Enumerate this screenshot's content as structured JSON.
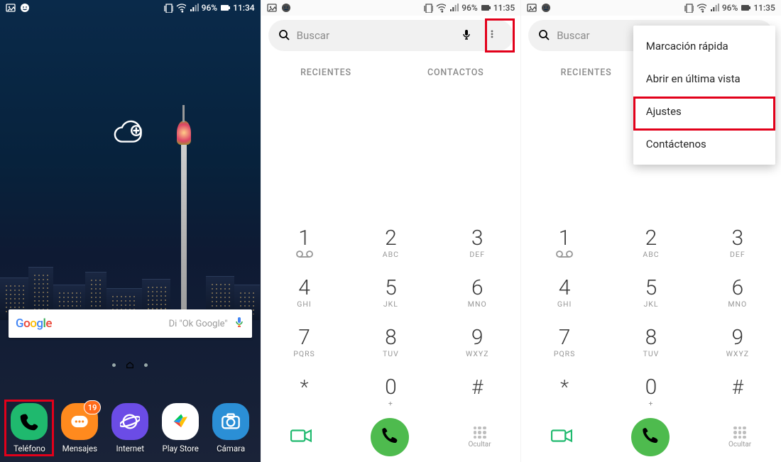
{
  "status_home": {
    "battery": "96%",
    "time": "11:34"
  },
  "status_phone": {
    "battery": "96%",
    "time": "11:35"
  },
  "home": {
    "search_hint": "Di \"Ok Google\"",
    "google": "Google",
    "apps": {
      "phone": "Teléfono",
      "messages": "Mensajes",
      "internet": "Internet",
      "playstore": "Play Store",
      "camera": "Cámara",
      "msg_badge": "19"
    }
  },
  "phone": {
    "search_placeholder": "Buscar",
    "tab_recent": "RECIENTES",
    "tab_contacts": "CONTACTOS",
    "keys": [
      {
        "n": "1",
        "s": ""
      },
      {
        "n": "2",
        "s": "ABC"
      },
      {
        "n": "3",
        "s": "DEF"
      },
      {
        "n": "4",
        "s": "GHI"
      },
      {
        "n": "5",
        "s": "JKL"
      },
      {
        "n": "6",
        "s": "MNO"
      },
      {
        "n": "7",
        "s": "PQRS"
      },
      {
        "n": "8",
        "s": "TUV"
      },
      {
        "n": "9",
        "s": "WXYZ"
      },
      {
        "n": "*",
        "s": ""
      },
      {
        "n": "0",
        "s": "+"
      },
      {
        "n": "#",
        "s": ""
      }
    ],
    "hide": "Ocultar"
  },
  "menu": {
    "speed": "Marcación rápida",
    "lastview": "Abrir en última vista",
    "settings": "Ajustes",
    "contact": "Contáctenos"
  }
}
